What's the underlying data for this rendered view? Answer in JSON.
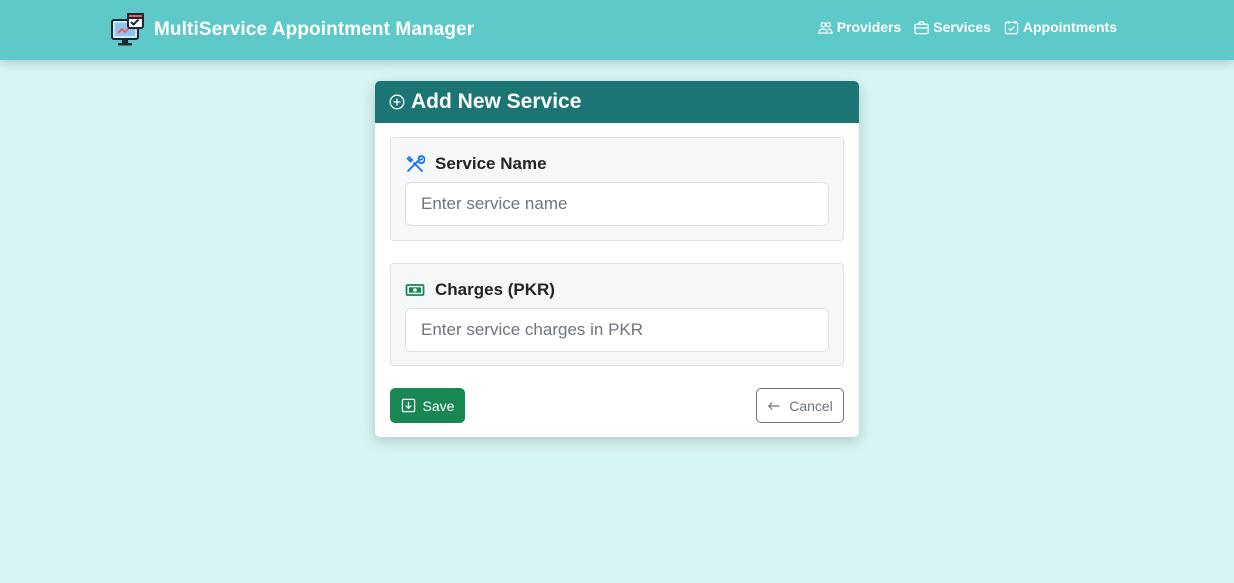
{
  "navbar": {
    "brand_title": "MultiService Appointment Manager",
    "brand_logo_icon": "computer-calendar-icon",
    "links": [
      {
        "label": "Providers",
        "icon": "people-icon"
      },
      {
        "label": "Services",
        "icon": "briefcase-icon"
      },
      {
        "label": "Appointments",
        "icon": "calendar-check-icon"
      }
    ],
    "background_color": "#5ec9c9"
  },
  "page": {
    "background_color": "#d6f5f3"
  },
  "card": {
    "title": "Add New Service",
    "title_icon": "plus-circle-icon",
    "header_color": "#1b7574",
    "fields": [
      {
        "label": "Service Name",
        "icon": "tools-icon",
        "icon_color": "#0d6efd",
        "value": "",
        "placeholder": "Enter service name"
      },
      {
        "label": "Charges (PKR)",
        "icon": "cash-icon",
        "icon_color": "#198754",
        "value": "",
        "placeholder": "Enter service charges in PKR"
      }
    ],
    "save_button": {
      "label": "Save",
      "icon": "download-icon",
      "color": "#198754"
    },
    "cancel_button": {
      "label": "Cancel",
      "icon": "arrow-left-icon",
      "color": "#6c757d"
    }
  }
}
